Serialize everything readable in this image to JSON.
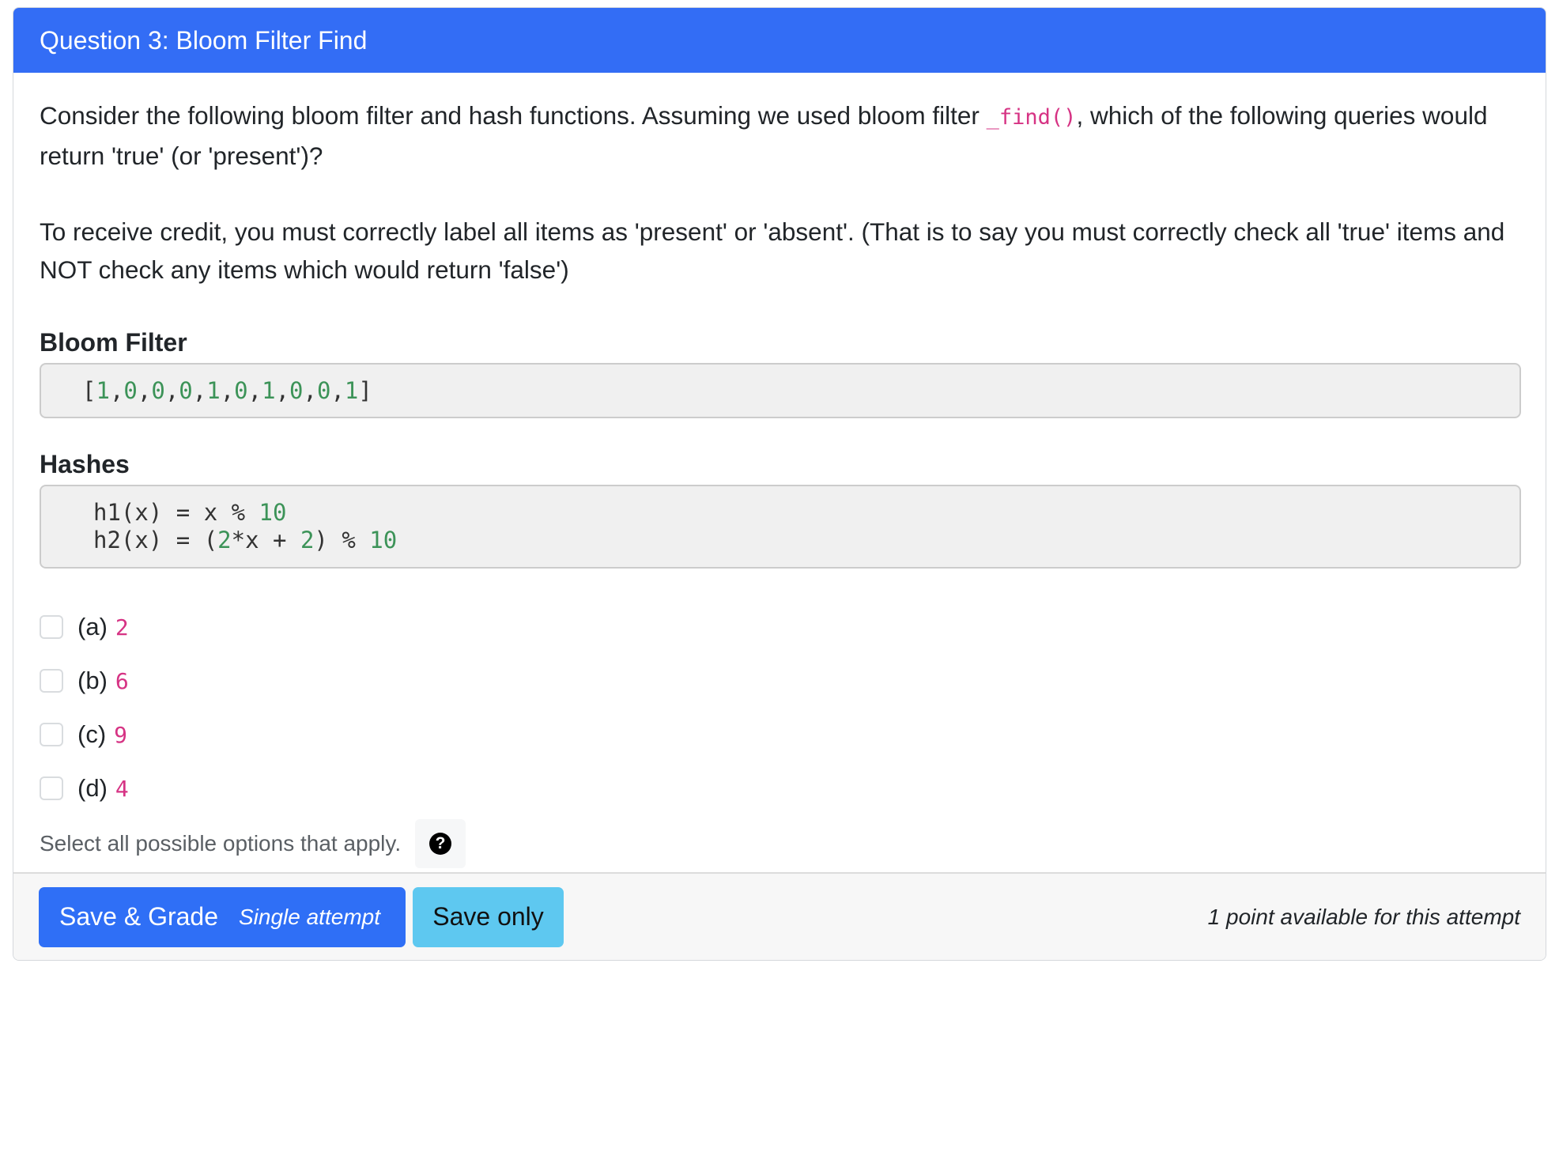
{
  "header": {
    "title": "Question 3: Bloom Filter Find"
  },
  "question": {
    "intro_before_code": "Consider the following bloom filter and hash functions. Assuming we used bloom filter ",
    "inline_code": "_find()",
    "intro_after_code": ", which of the following queries would return 'true' (or 'present')?",
    "credit_note": "To receive credit, you must correctly label all items as 'present' or 'absent'. (That is to say you must correctly check all 'true' items and NOT check any items which would return 'false')"
  },
  "bloom_filter": {
    "title": "Bloom Filter",
    "bits": [
      "1",
      "0",
      "0",
      "0",
      "1",
      "0",
      "1",
      "0",
      "0",
      "1"
    ]
  },
  "hashes": {
    "title": "Hashes",
    "h1": {
      "lhs": "h1(x)",
      "eq": " = ",
      "expr_a": "x % ",
      "num": "10"
    },
    "h2": {
      "lhs": "h2(x)",
      "eq": " = ",
      "open": "(",
      "n1": "2",
      "mid": "*x + ",
      "n2": "2",
      "close": ") % ",
      "n3": "10"
    }
  },
  "options": [
    {
      "letter": "(a)",
      "value": "2",
      "checked": false
    },
    {
      "letter": "(b)",
      "value": "6",
      "checked": false
    },
    {
      "letter": "(c)",
      "value": "9",
      "checked": false
    },
    {
      "letter": "(d)",
      "value": "4",
      "checked": false
    }
  ],
  "help": {
    "text": "Select all possible options that apply.",
    "icon": "question-circle-icon",
    "glyph": "?"
  },
  "footer": {
    "grade_label": "Save & Grade",
    "grade_sub": "Single attempt",
    "save_label": "Save only",
    "note": "1 point available for this attempt"
  },
  "colors": {
    "header_bg": "#336df5",
    "grade_button": "#2f6ff6",
    "save_button": "#5ec8f0",
    "code_number": "#3c9358",
    "inline_code": "#d63384"
  }
}
